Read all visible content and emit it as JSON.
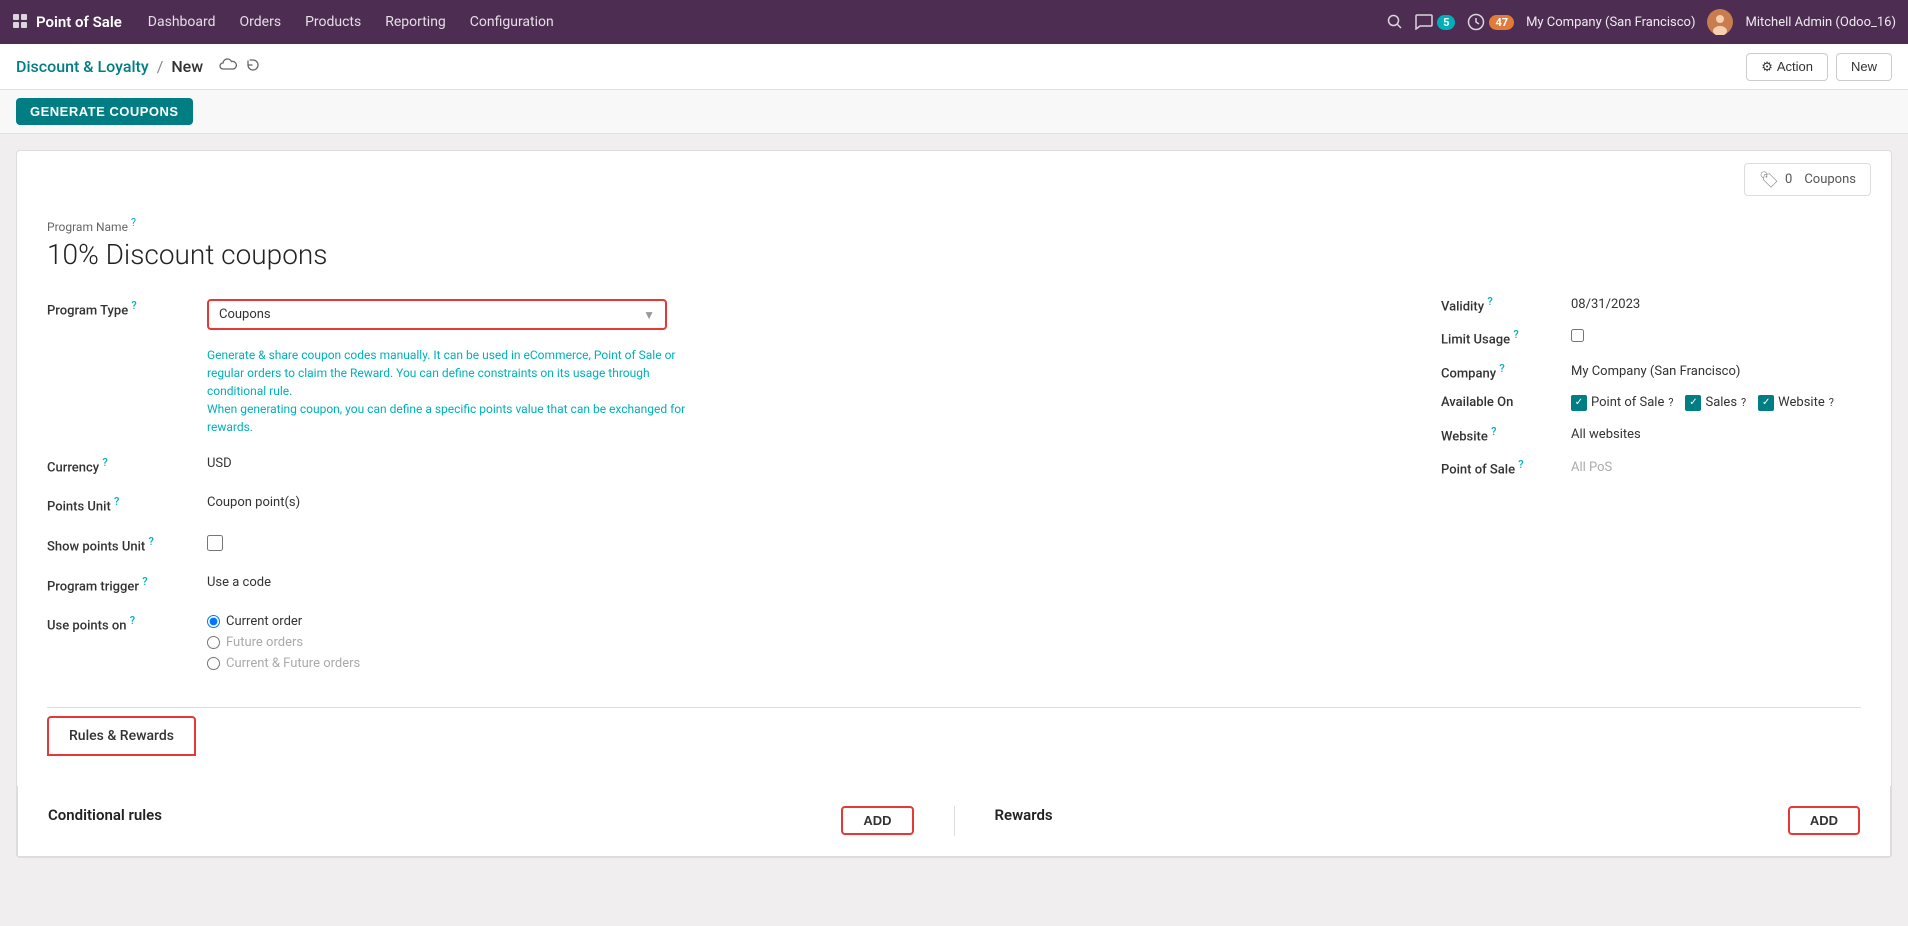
{
  "topbar": {
    "app_name": "Point of Sale",
    "nav_items": [
      "Dashboard",
      "Orders",
      "Products",
      "Reporting",
      "Configuration"
    ],
    "company": "My Company (San Francisco)",
    "user": "Mitchell Admin (Odoo_16)",
    "messages_count": "5",
    "activities_count": "47"
  },
  "breadcrumb": {
    "parent": "Discount & Loyalty",
    "current": "New",
    "action_label": "Action",
    "new_label": "New",
    "gear_icon": "⚙"
  },
  "action_bar": {
    "generate_coupons": "GENERATE COUPONS"
  },
  "form": {
    "coupons_count": "0",
    "coupons_label": "Coupons",
    "program_name_label": "Program Name",
    "program_title": "10% Discount coupons",
    "program_type_label": "Program Type",
    "program_type_value": "Coupons",
    "program_type_desc": "Generate & share coupon codes manually. It can be used in eCommerce, Point of Sale or regular orders to claim the Reward. You can define constraints on its usage through conditional rule.\nWhen generating coupon, you can define a specific points value that can be exchanged for rewards.",
    "currency_label": "Currency",
    "currency_value": "USD",
    "points_unit_label": "Points Unit",
    "points_unit_value": "Coupon point(s)",
    "show_points_label": "Show points Unit",
    "program_trigger_label": "Program trigger",
    "program_trigger_value": "Use a code",
    "use_points_label": "Use points on",
    "use_points_options": [
      {
        "value": "current",
        "label": "Current order",
        "checked": true
      },
      {
        "value": "future",
        "label": "Future orders",
        "checked": false
      },
      {
        "value": "both",
        "label": "Current & Future orders",
        "checked": false
      }
    ],
    "validity_label": "Validity",
    "validity_value": "08/31/2023",
    "limit_usage_label": "Limit Usage",
    "company_label": "Company",
    "company_value": "My Company (San Francisco)",
    "available_on_label": "Available On",
    "available_on_items": [
      {
        "label": "Point of Sale",
        "checked": true
      },
      {
        "label": "Sales",
        "checked": true
      },
      {
        "label": "Website",
        "checked": true
      }
    ],
    "website_label": "Website",
    "website_placeholder": "All websites",
    "pos_label": "Point of Sale",
    "pos_placeholder": "All PoS"
  },
  "tabs": {
    "rules_rewards": "Rules & Rewards"
  },
  "bottom": {
    "conditional_rules_title": "Conditional rules",
    "add_label": "ADD",
    "rewards_title": "Rewards",
    "rewards_add_label": "ADD"
  }
}
